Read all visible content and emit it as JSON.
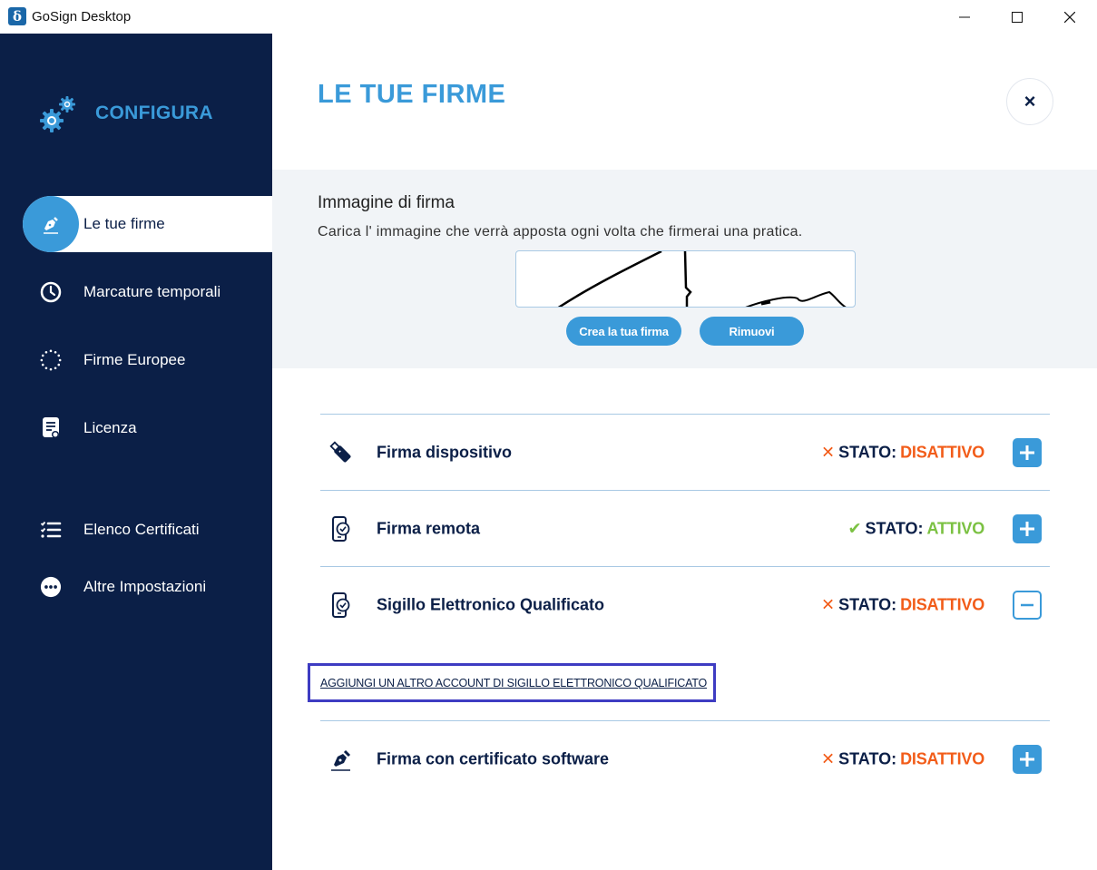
{
  "window": {
    "title": "GoSign Desktop",
    "logo_letter": "δ"
  },
  "sidebar": {
    "header": "CONFIGURA",
    "items": [
      {
        "label": "Le tue firme",
        "icon": "pen-icon",
        "active": true
      },
      {
        "label": "Marcature temporali",
        "icon": "clock-icon"
      },
      {
        "label": "Firme Europee",
        "icon": "eu-stars-icon"
      },
      {
        "label": "Licenza",
        "icon": "license-icon"
      },
      {
        "label": "Elenco Certificati",
        "icon": "list-icon"
      },
      {
        "label": "Altre Impostazioni",
        "icon": "more-icon"
      }
    ]
  },
  "main": {
    "title": "LE TUE FIRME",
    "close_glyph": "×",
    "signature": {
      "title": "Immagine di firma",
      "description": "Carica l' immagine che verrà apposta ogni volta che firmerai una pratica.",
      "create_label": "Crea la tua firma",
      "remove_label": "Rimuovi"
    },
    "status_prefix": "STATO:",
    "rows": [
      {
        "label": "Firma dispositivo",
        "status": "DISATTIVO",
        "active": false,
        "expanded": false,
        "icon": "usb-key-icon"
      },
      {
        "label": "Firma remota",
        "status": "ATTIVO",
        "active": true,
        "expanded": false,
        "icon": "phone-check-icon"
      },
      {
        "label": "Sigillo Elettronico Qualificato",
        "status": "DISATTIVO",
        "active": false,
        "expanded": true,
        "icon": "phone-check-icon"
      },
      {
        "label": "Firma con certificato software",
        "status": "DISATTIVO",
        "active": false,
        "expanded": false,
        "icon": "pen-icon"
      }
    ],
    "add_account_link": "AGGIUNGI UN ALTRO ACCOUNT DI SIGILLO ELETTRONICO QUALIFICATO"
  },
  "colors": {
    "sidebar_bg": "#0b1f47",
    "accent": "#3a9ad9",
    "inactive": "#f25c19",
    "active": "#7bc142",
    "highlight_border": "#3e3cc2"
  }
}
